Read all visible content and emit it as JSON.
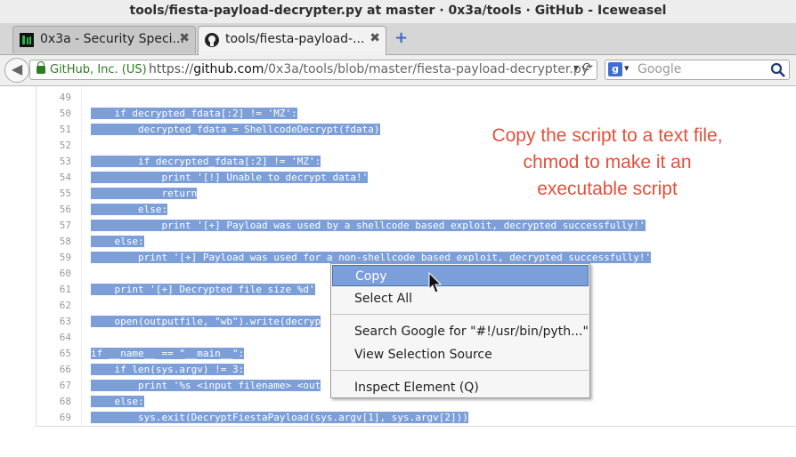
{
  "window": {
    "title": "tools/fiesta-payload-decrypter.py at master · 0x3a/tools · GitHub - Iceweasel"
  },
  "tabs": [
    {
      "label": "0x3a - Security Speci...",
      "close": "✖"
    },
    {
      "label": "tools/fiesta-payload-...",
      "close": "✖"
    }
  ],
  "newtab": "+",
  "navbar": {
    "identity": "GitHub, Inc. (US)",
    "url_scheme": "https://",
    "url_host": "github.com",
    "url_path": "/0x3a/tools/blob/master/fiesta-payload-decrypter.py",
    "search_placeholder": "Google",
    "search_engine_letter": "g"
  },
  "code": {
    "lines": [
      {
        "num": "49",
        "text": ""
      },
      {
        "num": "50",
        "text": "    if decrypted_fdata[:2] != 'MZ':"
      },
      {
        "num": "51",
        "text": "        decrypted_fdata = ShellcodeDecrypt(fdata)"
      },
      {
        "num": "52",
        "text": ""
      },
      {
        "num": "53",
        "text": "        if decrypted_fdata[:2] != 'MZ':"
      },
      {
        "num": "54",
        "text": "            print '[!] Unable to decrypt data!'"
      },
      {
        "num": "55",
        "text": "            return"
      },
      {
        "num": "56",
        "text": "        else:"
      },
      {
        "num": "57",
        "text": "            print '[+] Payload was used by a shellcode based exploit, decrypted successfully!'"
      },
      {
        "num": "58",
        "text": "    else:"
      },
      {
        "num": "59",
        "text": "        print '[+] Payload was used for a non-shellcode based exploit, decrypted successfully!'"
      },
      {
        "num": "60",
        "text": ""
      },
      {
        "num": "61",
        "text": "    print '[+] Decrypted file size %d'"
      },
      {
        "num": "62",
        "text": ""
      },
      {
        "num": "63",
        "text": "    open(outputfile, \"wb\").write(decryp"
      },
      {
        "num": "64",
        "text": ""
      },
      {
        "num": "65",
        "text": "if __name__ == \"__main__\":"
      },
      {
        "num": "66",
        "text": "    if len(sys.argv) != 3:"
      },
      {
        "num": "67",
        "text": "        print '%s <input filename> <out"
      },
      {
        "num": "68",
        "text": "    else:"
      },
      {
        "num": "69",
        "text": "        sys.exit(DecryptFiestaPayload(sys.argv[1], sys.argv[2]))"
      }
    ]
  },
  "annotation": {
    "line1": "Copy the script to a text file,",
    "line2": "chmod to make it an",
    "line3": "executable script"
  },
  "context_menu": {
    "items": [
      "Copy",
      "Select All",
      "Search Google for \"#!/usr/bin/pyth...\"",
      "View Selection Source",
      "Inspect Element (Q)"
    ],
    "highlighted": "Copy"
  },
  "colors": {
    "selection": "#7d9fd8",
    "annotation": "#e4503a",
    "menu_highlight": "#7b9fd9"
  }
}
